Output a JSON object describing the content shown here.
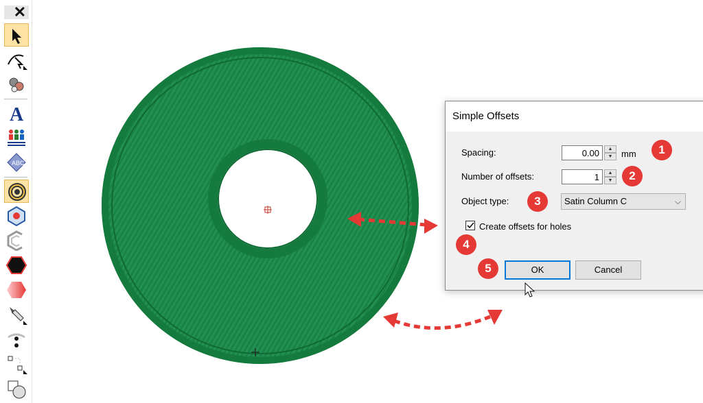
{
  "toolbar": {
    "close_glyph": "✕",
    "tools": [
      {
        "icon": "select-arrow-icon",
        "active": true
      },
      {
        "icon": "reshape-icon",
        "active": false
      },
      {
        "icon": "color-picker-icon",
        "active": false
      },
      {
        "icon": "lettering-icon",
        "active": false
      },
      {
        "icon": "team-names-icon",
        "active": false
      },
      {
        "icon": "monogram-icon",
        "active": false
      },
      {
        "icon": "simple-offsets-icon",
        "active": true
      },
      {
        "icon": "outline-icon",
        "active": false
      },
      {
        "icon": "partial-outline-icon",
        "active": false
      },
      {
        "icon": "fill-hexagon-icon",
        "active": false
      },
      {
        "icon": "gradient-fill-icon",
        "active": false
      },
      {
        "icon": "pen-tool-icon",
        "active": false
      },
      {
        "icon": "stitch-point-icon",
        "active": false
      },
      {
        "icon": "node-edit-icon",
        "active": false
      },
      {
        "icon": "shape-icon",
        "active": false
      }
    ]
  },
  "design": {
    "fill_color": "#1e8a4c",
    "border_color": "#157a3e"
  },
  "dialog": {
    "title": "Simple Offsets",
    "spacing_label": "Spacing:",
    "spacing_value": "0.00",
    "spacing_unit": "mm",
    "offsets_label": "Number of offsets:",
    "offsets_value": "1",
    "object_type_label": "Object type:",
    "object_type_value": "Satin Column C",
    "holes_label": "Create offsets for holes",
    "holes_checked": true,
    "ok_label": "OK",
    "cancel_label": "Cancel"
  },
  "annotations": {
    "badges": [
      "1",
      "2",
      "3",
      "4",
      "5"
    ],
    "color": "#e53935"
  }
}
